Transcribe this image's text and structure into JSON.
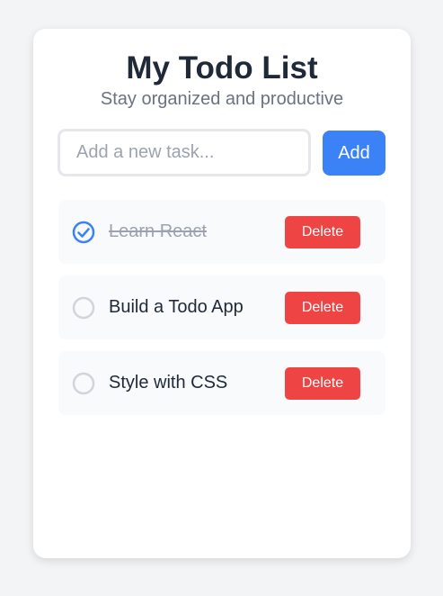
{
  "header": {
    "title": "My Todo List",
    "subtitle": "Stay organized and productive"
  },
  "new_task": {
    "placeholder": "Add a new task...",
    "value": "",
    "add_label": "Add"
  },
  "todos": [
    {
      "text": "Learn React",
      "completed": true,
      "delete_label": "Delete"
    },
    {
      "text": "Build a Todo App",
      "completed": false,
      "delete_label": "Delete"
    },
    {
      "text": "Style with CSS",
      "completed": false,
      "delete_label": "Delete"
    }
  ],
  "colors": {
    "accent": "#3b82f6",
    "danger": "#ef4444",
    "checked": "#3b82f6",
    "unchecked_border": "#d1d5db"
  },
  "icons": {
    "completed": "check-circle-icon",
    "pending": "empty-circle-icon"
  }
}
